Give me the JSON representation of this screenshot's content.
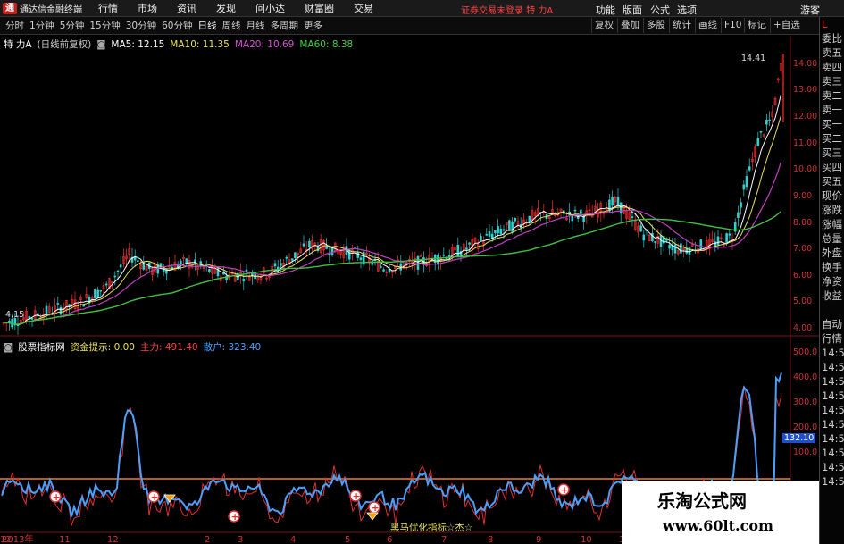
{
  "app": {
    "title": "通达信金融终端",
    "logo": "logo-icon"
  },
  "menu": [
    "行情",
    "市场",
    "资讯",
    "发现",
    "问小达",
    "财富圈",
    "交易"
  ],
  "login_status": "证券交易未登录  特 力A",
  "right_menu": [
    "功能",
    "版面",
    "公式",
    "选项",
    "游客"
  ],
  "periods": [
    "分时",
    "1分钟",
    "5分钟",
    "15分钟",
    "30分钟",
    "60分钟",
    "日线",
    "周线",
    "月线",
    "多周期",
    "更多"
  ],
  "active_period": "日线",
  "toolbar_right": [
    "复权",
    "叠加",
    "多股",
    "统计",
    "画线",
    "F10",
    "标记",
    "+自选"
  ],
  "main_info": {
    "name": "特 力A",
    "mode": "(日线前复权)",
    "ma5": "MA5: 12.15",
    "ma10": "MA10: 11.35",
    "ma20": "MA20: 10.69",
    "ma60": "MA60: 8.38"
  },
  "colors": {
    "ma5": "#ffffff",
    "ma10": "#e8e060",
    "ma20": "#c040c0",
    "ma60": "#40c040",
    "up": "#ff3030",
    "down": "#30d0d0",
    "vol_line": "#4aa0ff"
  },
  "price_axis": [
    "14.00",
    "13.00",
    "12.00",
    "11.00",
    "10.00",
    "9.00",
    "8.00",
    "7.00",
    "6.00",
    "5.00",
    "4.00"
  ],
  "price_high_label": "14.41",
  "price_low_label": "4.15",
  "sub_info": {
    "name": "股票指标网",
    "hint": "资金提示: 0.00",
    "main": "主力: 491.40",
    "retail": "散户: 323.40"
  },
  "sub_axis": [
    "500.0",
    "400.0",
    "300.0",
    "200.0",
    "100.0"
  ],
  "sub_value_badge": "132.10",
  "formula_label": "黑马优化指标☆杰☆",
  "date_axis": [
    "2013年",
    "11",
    "12",
    "2",
    "3",
    "4",
    "5",
    "6",
    "7",
    "8",
    "9",
    "10",
    "11",
    "12"
  ],
  "quote_panel": [
    "L",
    "委比",
    "卖五",
    "卖四",
    "卖三",
    "卖二",
    "卖一",
    "买一",
    "买二",
    "买三",
    "买四",
    "买五",
    "现价",
    "涨跌",
    "涨幅",
    "总量",
    "外盘",
    "换手",
    "净资",
    "收益",
    "",
    "自动",
    "行情",
    "14:5",
    "14:5",
    "14:5",
    "14:5",
    "14:5",
    "14:5",
    "14:5",
    "14:5",
    "14:5",
    "14:5"
  ],
  "watermark": {
    "line1": "乐淘公式网",
    "line2": "www.60lt.com"
  },
  "chart_data": {
    "type": "candlestick",
    "price_range": [
      4,
      14.5
    ],
    "ma60_close": [
      4.2,
      4.6,
      5.2,
      5.8,
      6.0,
      6.3,
      6.6,
      6.9,
      7.1,
      7.4,
      7.8,
      8.2,
      8.4,
      8.6,
      8.3,
      7.7,
      7.8,
      8.38
    ]
  }
}
